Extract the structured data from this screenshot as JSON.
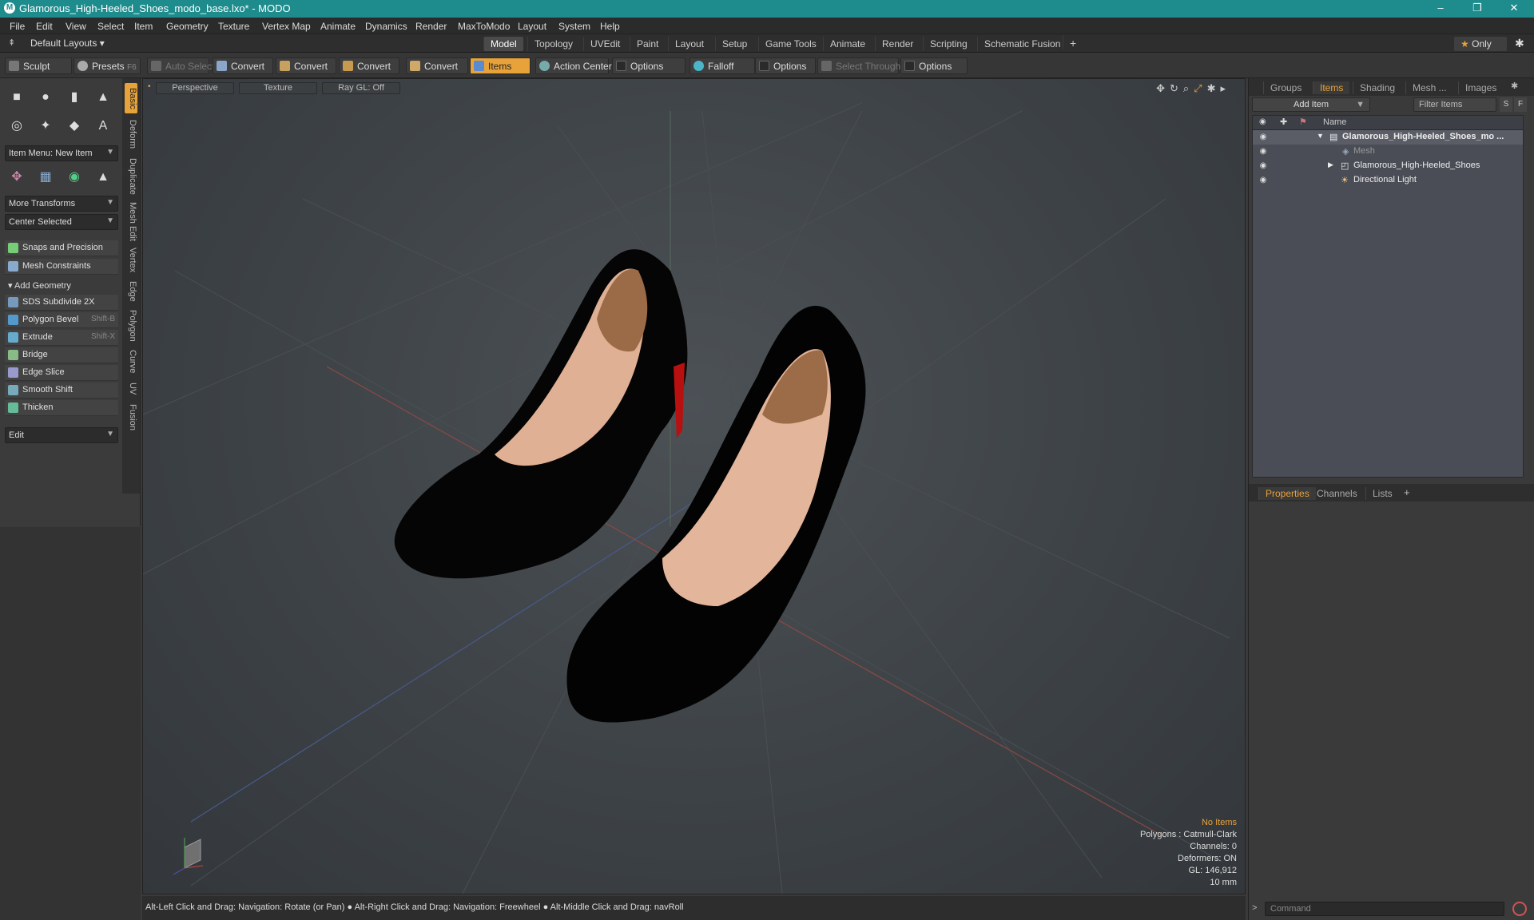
{
  "window": {
    "title": "Glamorous_High-Heeled_Shoes_modo_base.lxo* - MODO",
    "minimize": "–",
    "maximize": "❐",
    "close": "✕"
  },
  "menu": [
    "File",
    "Edit",
    "View",
    "Select",
    "Item",
    "Geometry",
    "Texture",
    "Vertex Map",
    "Animate",
    "Dynamics",
    "Render",
    "MaxToModo",
    "Layout",
    "System",
    "Help"
  ],
  "layout": {
    "default_layouts": "Default Layouts",
    "tabs": [
      "Model",
      "Topology",
      "UVEdit",
      "Paint",
      "Layout",
      "Setup",
      "Game Tools",
      "Animate",
      "Render",
      "Scripting",
      "Schematic Fusion"
    ],
    "active_tab": "Model",
    "plus": "+",
    "only": "Only"
  },
  "toolbar": {
    "sculpt": "Sculpt",
    "presets": "Presets",
    "presets_key": "F6",
    "auto_select": "Auto Select",
    "convert1": "Convert",
    "convert2": "Convert",
    "convert3": "Convert",
    "convert4": "Convert",
    "items": "Items",
    "action_center": "Action Center",
    "options1": "Options",
    "falloff": "Falloff",
    "options2": "Options",
    "select_through": "Select Through",
    "options3": "Options"
  },
  "left": {
    "item_menu": "Item Menu: New Item",
    "more_transforms": "More Transforms",
    "center_selected": "Center Selected",
    "snaps": "Snaps and Precision",
    "mesh_constraints": "Mesh Constraints",
    "add_geometry": "Add Geometry",
    "tools": [
      {
        "label": "SDS Subdivide 2X",
        "shortcut": ""
      },
      {
        "label": "Polygon Bevel",
        "shortcut": "Shift-B"
      },
      {
        "label": "Extrude",
        "shortcut": "Shift-X"
      },
      {
        "label": "Bridge",
        "shortcut": ""
      },
      {
        "label": "Edge Slice",
        "shortcut": ""
      },
      {
        "label": "Smooth Shift",
        "shortcut": ""
      },
      {
        "label": "Thicken",
        "shortcut": ""
      }
    ],
    "edit": "Edit",
    "vtabs": [
      "Basic",
      "Deform",
      "Duplicate",
      "Mesh Edit",
      "Vertex",
      "Edge",
      "Polygon",
      "Curve",
      "UV",
      "Fusion"
    ]
  },
  "viewport": {
    "perspective": "Perspective",
    "texture": "Texture",
    "raygl": "Ray GL: Off",
    "info": {
      "no_items": "No Items",
      "polygons": "Polygons : Catmull-Clark",
      "channels": "Channels: 0",
      "deformers": "Deformers: ON",
      "gl": "GL: 146,912",
      "unit": "10 mm"
    }
  },
  "status": "Alt-Left Click and Drag: Navigation: Rotate (or Pan) ● Alt-Right Click and Drag: Navigation: Freewheel ● Alt-Middle Click and Drag: navRoll",
  "right": {
    "tabs": [
      "Groups",
      "Items",
      "Shading",
      "Mesh ...",
      "Images"
    ],
    "active_tab": "Items",
    "add_item": "Add Item",
    "filter_items": "Filter Items",
    "s": "S",
    "f": "F",
    "name_col": "Name",
    "tree": [
      {
        "label": "Glamorous_High-Heeled_Shoes_mo ...",
        "indent": 0
      },
      {
        "label": "Mesh",
        "indent": 1
      },
      {
        "label": "Glamorous_High-Heeled_Shoes",
        "indent": 1
      },
      {
        "label": "Directional Light",
        "indent": 1
      }
    ],
    "prop_tabs": [
      "Properties",
      "Channels",
      "Lists"
    ],
    "command": "Command"
  },
  "colors": {
    "accent": "#e8a23a",
    "title": "#1e8c8c"
  }
}
